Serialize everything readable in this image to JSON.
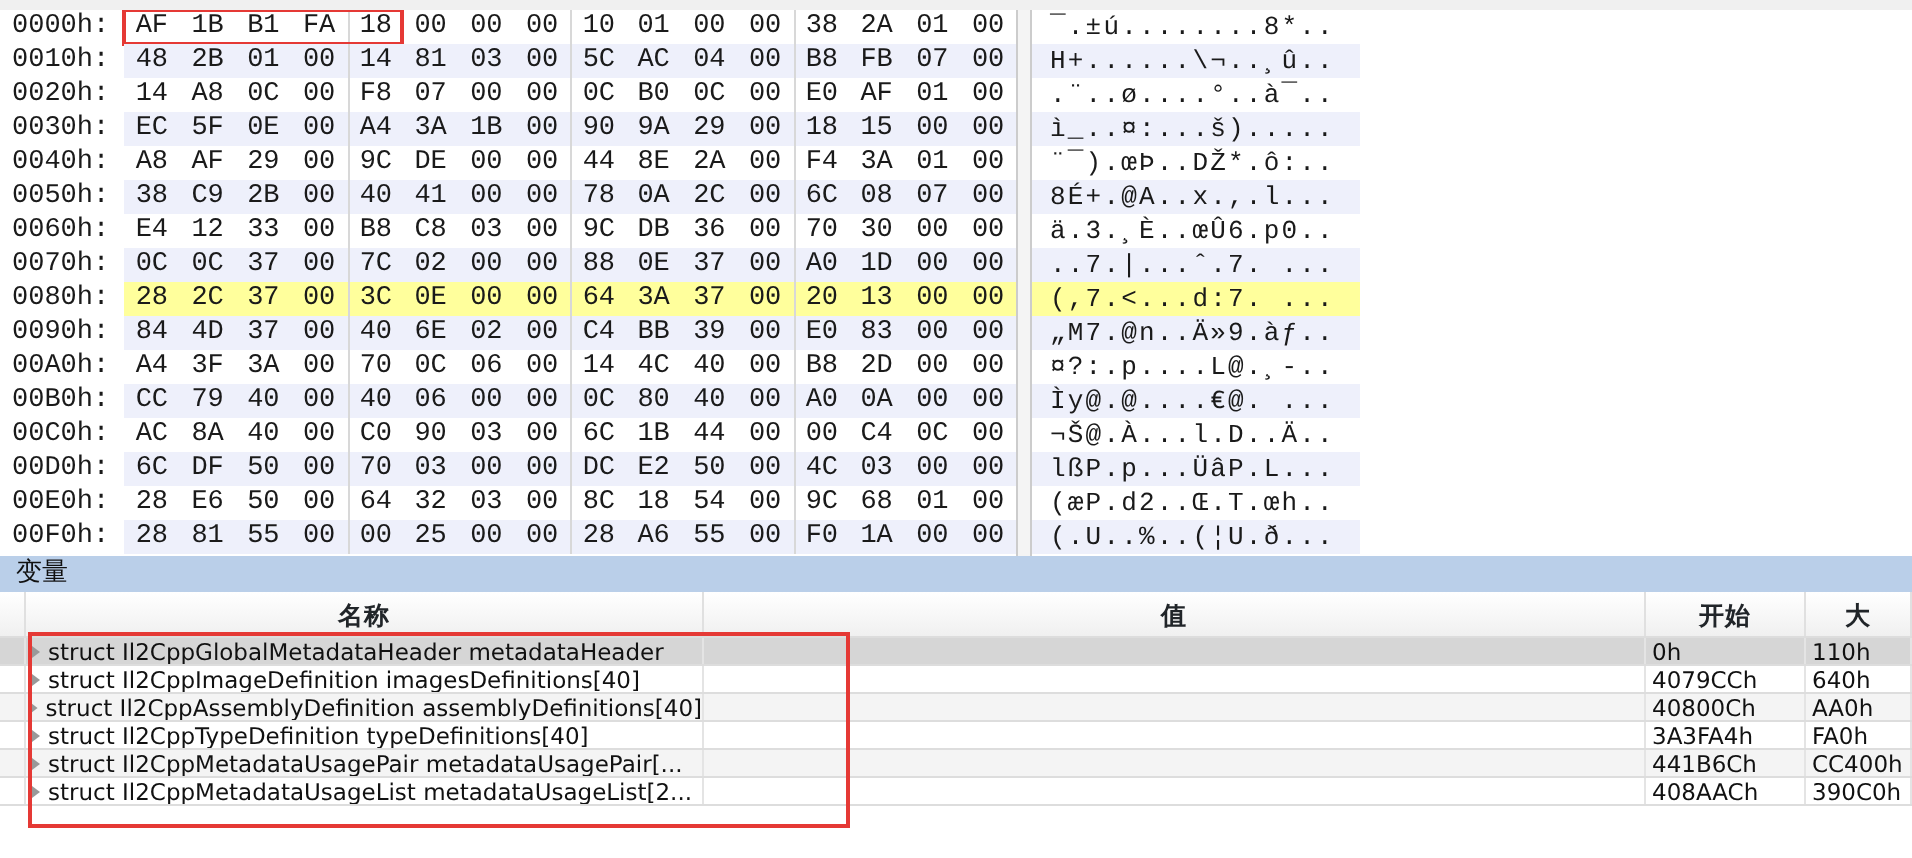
{
  "hex_view": {
    "rows": [
      {
        "address": "0000h:",
        "boxed_bytes": "AF 1B B1 FA 18",
        "bytes": "00 00 00 10 01 00 00 38 2A 01 00",
        "text": "¯.±ú........8*..",
        "highlighted": false
      },
      {
        "address": "0010h:",
        "bytes": "48 2B 01 00 14 81 03 00 5C AC 04 00 B8 FB 07 00",
        "text": "H+......\\¬..¸û..",
        "highlighted": false
      },
      {
        "address": "0020h:",
        "bytes": "14 A8 0C 00 F8 07 00 00 0C B0 0C 00 E0 AF 01 00",
        "text": ".¨..ø....°..à¯..",
        "highlighted": false
      },
      {
        "address": "0030h:",
        "bytes": "EC 5F 0E 00 A4 3A 1B 00 90 9A 29 00 18 15 00 00",
        "text": "ì_..¤:...š).....",
        "highlighted": false
      },
      {
        "address": "0040h:",
        "bytes": "A8 AF 29 00 9C DE 00 00 44 8E 2A 00 F4 3A 01 00",
        "text": "¨¯).œÞ..DŽ*.ô:..",
        "highlighted": false
      },
      {
        "address": "0050h:",
        "bytes": "38 C9 2B 00 40 41 00 00 78 0A 2C 00 6C 08 07 00",
        "text": "8É+.@A..x.,.l...",
        "highlighted": false
      },
      {
        "address": "0060h:",
        "bytes": "E4 12 33 00 B8 C8 03 00 9C DB 36 00 70 30 00 00",
        "text": "ä.3.¸È..œÛ6.p0..",
        "highlighted": false
      },
      {
        "address": "0070h:",
        "bytes": "0C 0C 37 00 7C 02 00 00 88 0E 37 00 A0 1D 00 00",
        "text": "..7.|...ˆ.7. ...",
        "highlighted": false
      },
      {
        "address": "0080h:",
        "bytes": "28 2C 37 00 3C 0E 00 00 64 3A 37 00 20 13 00 00",
        "text": "(,7.<...d:7. ...",
        "highlighted": true
      },
      {
        "address": "0090h:",
        "bytes": "84 4D 37 00 40 6E 02 00 C4 BB 39 00 E0 83 00 00",
        "text": "„M7.@n..Ä»9.àƒ..",
        "highlighted": false
      },
      {
        "address": "00A0h:",
        "bytes": "A4 3F 3A 00 70 0C 06 00 14 4C 40 00 B8 2D 00 00",
        "text": "¤?:.p....L@.¸-..",
        "highlighted": false
      },
      {
        "address": "00B0h:",
        "bytes": "CC 79 40 00 40 06 00 00 0C 80 40 00 A0 0A 00 00",
        "text": "Ìy@.@....€@. ...",
        "highlighted": false
      },
      {
        "address": "00C0h:",
        "bytes": "AC 8A 40 00 C0 90 03 00 6C 1B 44 00 00 C4 0C 00",
        "text": "¬Š@.À...l.D..Ä..",
        "highlighted": false
      },
      {
        "address": "00D0h:",
        "bytes": "6C DF 50 00 70 03 00 00 DC E2 50 00 4C 03 00 00",
        "text": "lßP.p...ÜâP.L...",
        "highlighted": false
      },
      {
        "address": "00E0h:",
        "bytes": "28 E6 50 00 64 32 03 00 8C 18 54 00 9C 68 01 00",
        "text": "(æP.d2..Œ.T.œh..",
        "highlighted": false
      },
      {
        "address": "00F0h:",
        "bytes": "28 81 55 00 00 25 00 00 28 A6 55 00 F0 1A 00 00",
        "text": "(.U..%..(¦U.ð...",
        "highlighted": false
      }
    ]
  },
  "variables_panel": {
    "title": "变量",
    "annotation_box": true,
    "columns": [
      "名称",
      "值",
      "开始",
      "大"
    ],
    "rows": [
      {
        "name": "struct Il2CppGlobalMetadataHeader metadataHeader",
        "start": "0h",
        "size": "110h",
        "selected": true
      },
      {
        "name": "struct Il2CppImageDefinition imagesDefinitions[40]",
        "start": "4079CCh",
        "size": "640h",
        "selected": false
      },
      {
        "name": "struct Il2CppAssemblyDefinition assemblyDefinitions[40]",
        "start": "40800Ch",
        "size": "AA0h",
        "selected": false
      },
      {
        "name": "struct Il2CppTypeDefinition typeDefinitions[40]",
        "start": "3A3FA4h",
        "size": "FA0h",
        "selected": false
      },
      {
        "name": "struct Il2CppMetadataUsagePair metadataUsagePair[...",
        "start": "441B6Ch",
        "size": "CC400h",
        "selected": false
      },
      {
        "name": "struct Il2CppMetadataUsageList metadataUsageList[2...",
        "start": "408AACh",
        "size": "390C0h",
        "selected": false
      }
    ]
  }
}
